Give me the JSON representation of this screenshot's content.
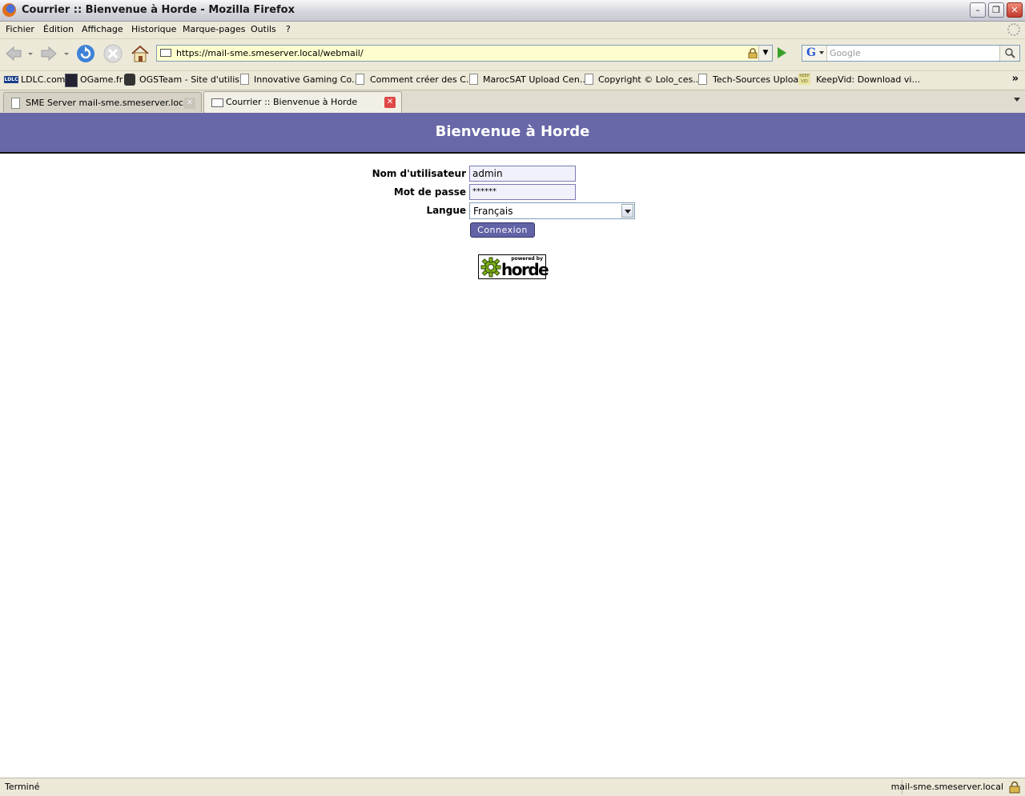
{
  "window": {
    "title": "Courrier :: Bienvenue à Horde - Mozilla Firefox"
  },
  "menubar": {
    "items": [
      "Fichier",
      "Édition",
      "Affichage",
      "Historique",
      "Marque-pages",
      "Outils",
      "?"
    ]
  },
  "navbar": {
    "url": "https://mail-sme.smeserver.local/webmail/",
    "search_placeholder": "Google"
  },
  "bookmarks": [
    {
      "label": "LDLC.com",
      "icon": "ldlc-icon"
    },
    {
      "label": "OGame.fr",
      "icon": "ogame-icon"
    },
    {
      "label": "OGSTeam - Site d'utilis...",
      "icon": "ogsteam-icon"
    },
    {
      "label": "Innovative Gaming Co...",
      "icon": "page-icon"
    },
    {
      "label": "Comment créer des C...",
      "icon": "page-icon"
    },
    {
      "label": "MarocSAT Upload Cen...",
      "icon": "page-icon"
    },
    {
      "label": "Copyright © Lolo_ces...",
      "icon": "page-icon"
    },
    {
      "label": "Tech-Sources Upload",
      "icon": "page-icon"
    },
    {
      "label": "KeepVid: Download vi...",
      "icon": "keepvid-icon"
    }
  ],
  "tabs": [
    {
      "label": "SME Server mail-sme.smeserver.local",
      "active": false
    },
    {
      "label": "Courrier :: Bienvenue à Horde",
      "active": true
    }
  ],
  "page": {
    "heading": "Bienvenue à Horde",
    "username_label": "Nom d'utilisateur",
    "username_value": "admin",
    "password_label": "Mot de passe",
    "password_value": "******",
    "language_label": "Langue",
    "language_value": "Français",
    "login_button": "Connexion",
    "logo_powered": "powered by",
    "logo_name": "horde"
  },
  "statusbar": {
    "status": "Terminé",
    "host": "mail-sme.smeserver.local"
  }
}
